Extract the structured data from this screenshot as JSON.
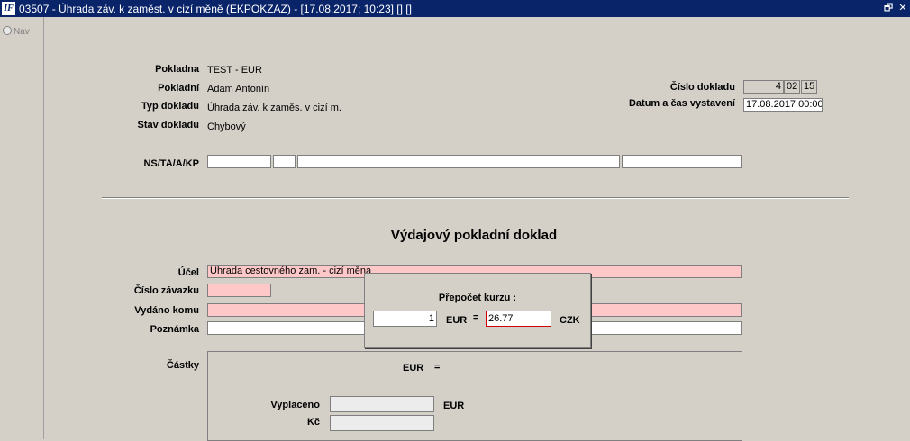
{
  "window": {
    "title": "03507 - Úhrada záv. k zaměst. v cizí měně (EKPOKZAZ) - [17.08.2017; 10:23]  [] []",
    "icon_text": "IF",
    "restore_glyph": "🗗",
    "close_glyph": "✕"
  },
  "sidebar": {
    "nav_label": "Nav"
  },
  "header": {
    "pokladna_label": "Pokladna",
    "pokladna_value": "TEST - EUR",
    "pokladni_label": "Pokladní",
    "pokladni_value": "Adam Antonín",
    "typ_label": "Typ dokladu",
    "typ_value": "Úhrada záv. k zaměs. v cizí m.",
    "stav_label": "Stav dokladu",
    "stav_value": "Chybový",
    "cislo_label": "Číslo dokladu",
    "cislo_parts": [
      "4",
      "02",
      "15"
    ],
    "datum_label": "Datum a čas vystavení",
    "datum_value": "17.08.2017 00:00",
    "ns_label": "NS/TA/A/KP",
    "ns_values": [
      "",
      "",
      "",
      ""
    ]
  },
  "document": {
    "title": "Výdajový pokladní doklad",
    "ucel_label": "Účel",
    "ucel_value": "Úhrada cestovného zam. - cizí měna",
    "cislo_zavazku_label": "Číslo závazku",
    "cislo_zavazku_value": "",
    "vydano_label": "Vydáno komu",
    "vydano_value": "",
    "poznamka_label": "Poznámka",
    "poznamka_value": ""
  },
  "amounts": {
    "label": "Částky",
    "eur_label": "EUR",
    "eq": "=",
    "vyplaceno_label": "Vyplaceno",
    "vyplaceno_value": "",
    "vyplaceno_currency": "EUR",
    "kc_label": "Kč",
    "kc_value": ""
  },
  "popup": {
    "title": "Přepočet kurzu :",
    "amount": "1",
    "from_currency": "EUR",
    "eq": "=",
    "rate": "26.77",
    "to_currency": "CZK"
  }
}
